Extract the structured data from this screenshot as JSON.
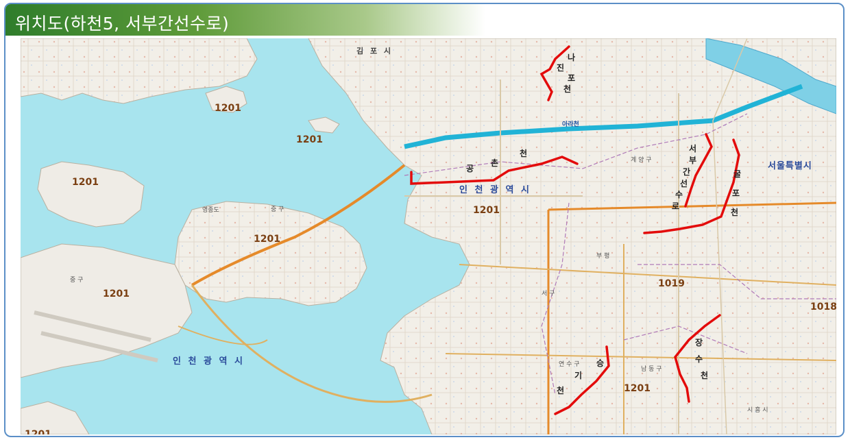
{
  "header": {
    "title": "위치도(하천5, 서부간선수로)"
  },
  "map": {
    "colors": {
      "sea": "#a8e4ee",
      "land": "#f3f0ea",
      "stream_highlight": "#e30b0b",
      "road": "#e58a2a",
      "canal": "#21b3d6"
    },
    "admin_labels": {
      "incheon_main": "인 천 광 역 시",
      "incheon_sea": "인 천 광 역 시",
      "gimpo": "김 포 시",
      "seoul": "서울특별시",
      "junggu_yeongjong": "중 구",
      "junggu_west": "중 구",
      "yeongjongdo": "영종도",
      "yeonsugu": "연 수 구",
      "namdonggu": "남 동 구",
      "siheung": "시 흥 시",
      "bupyeong": "부 평",
      "araecheon": "아라천",
      "gyeyang": "계 양 구",
      "seogu": "서 구"
    },
    "code_labels": [
      "1201",
      "1201",
      "1201",
      "1201",
      "1201",
      "1201",
      "1201",
      "1019",
      "1018",
      "1201"
    ],
    "stream_labels": {
      "najinpocheon": [
        "나",
        "진",
        "포",
        "천"
      ],
      "gongchoncheon": [
        "공",
        "촌",
        "천"
      ],
      "seobu_ganseon": [
        "서",
        "부",
        "간",
        "선",
        "수",
        "로"
      ],
      "gulpocheon": [
        "굴",
        "포",
        "천"
      ],
      "seunggicheon": [
        "승",
        "기",
        "천"
      ],
      "jangsucheon": [
        "장",
        "수",
        "천"
      ]
    }
  }
}
